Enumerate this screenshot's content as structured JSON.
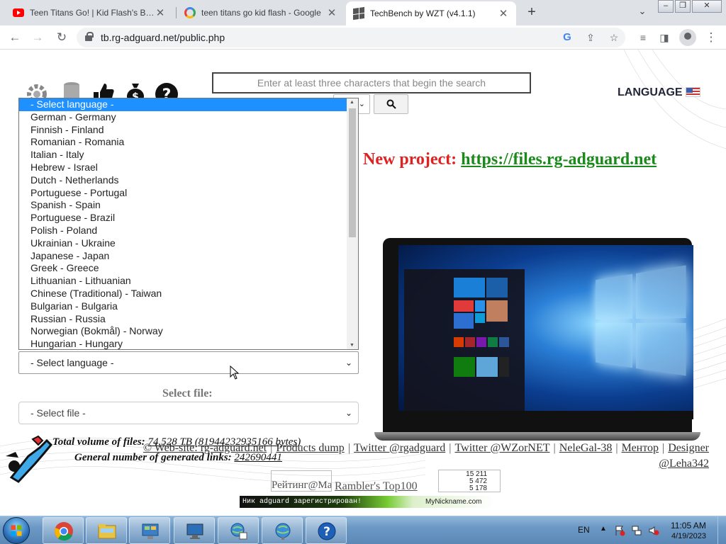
{
  "browser": {
    "tabs": [
      {
        "title": "Teen Titans Go! | Kid Flash's Best",
        "icon": "youtube-icon"
      },
      {
        "title": "teen titans go kid flash - Google",
        "icon": "google-icon"
      },
      {
        "title": "TechBench by WZT (v4.1.1)",
        "icon": "windows-favicon-icon"
      }
    ],
    "url": "tb.rg-adguard.net/public.php"
  },
  "page": {
    "search_placeholder": "Enter at least three characters that begin the search",
    "language_label": "LANGUAGE",
    "new_project_label": "New project:",
    "new_project_link": "https://files.rg-adguard.net",
    "language_options": [
      "- Select language -",
      "German - Germany",
      "Finnish - Finland",
      "Romanian - Romania",
      "Italian - Italy",
      "Hebrew - Israel",
      "Dutch - Netherlands",
      "Portuguese - Portugal",
      "Spanish - Spain",
      "Portuguese - Brazil",
      "Polish - Poland",
      "Ukrainian - Ukraine",
      "Japanese - Japan",
      "Greek - Greece",
      "Lithuanian - Lithuanian",
      "Chinese (Traditional) - Taiwan",
      "Bulgarian - Bulgaria",
      "Russian - Russia",
      "Norwegian (Bokmål) - Norway",
      "Hungarian - Hungary"
    ],
    "select_language_value": "- Select language -",
    "select_file_label": "Select file:",
    "select_file_value": "- Select file -",
    "total_volume_label": "Total volume of files:",
    "total_volume_value": "74.528 TB (81944232935166 bytes)",
    "generated_links_label": "General number of generated links:",
    "generated_links_value": "242690441",
    "footer_links": [
      "© Web-site: rg-adguard.net",
      "Products dump",
      "Twitter @rgadguard",
      "Twitter @WZorNET",
      "NeleGal-38",
      "Ментор",
      "Designer",
      "@Leha342"
    ],
    "counter_alt": "Рейтинг@Mail.ru",
    "rambler_alt": "Rambler's Top100",
    "counter_stats": [
      "15 211",
      "5 472",
      "5 178"
    ],
    "nick_banner_left": "Ник adguard зарегистрирован!",
    "nick_banner_right": "MyNickname.com"
  },
  "taskbar": {
    "lang": "EN",
    "time": "11:05 AM",
    "date": "4/19/2023"
  }
}
